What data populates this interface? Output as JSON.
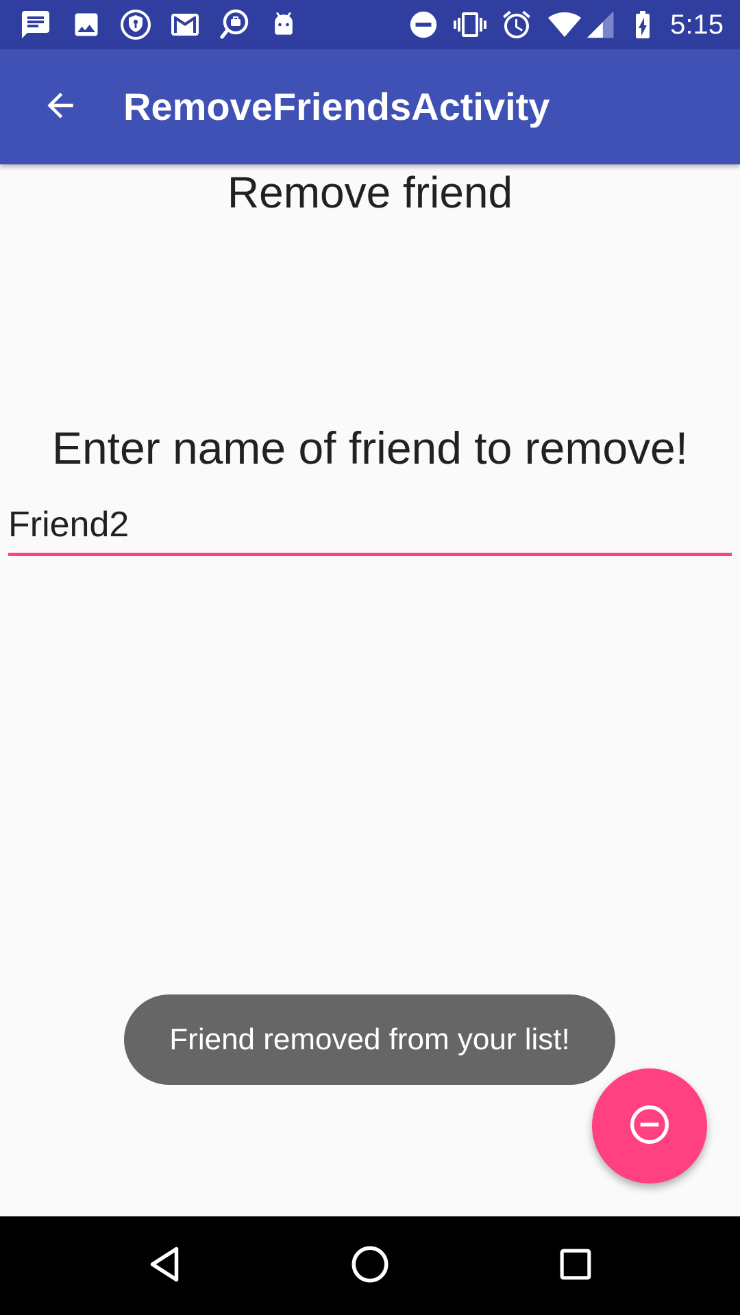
{
  "status_bar": {
    "time": "5:15",
    "left_icons": [
      "message-icon",
      "image-icon",
      "shield-key-icon",
      "gmail-icon",
      "chat-bubble-icon",
      "android-icon"
    ],
    "right_icons": [
      "do-not-disturb-icon",
      "vibrate-icon",
      "alarm-icon",
      "wifi-icon",
      "cell-signal-icon",
      "battery-charging-icon"
    ],
    "background": "#303f9f"
  },
  "app_bar": {
    "title": "RemoveFriendsActivity",
    "background": "#3f51b5"
  },
  "main": {
    "heading": "Remove friend",
    "prompt": "Enter name of friend to remove!",
    "name_input_value": "Friend2",
    "accent": "#ff4081"
  },
  "toast": {
    "message": "Friend removed from your list!"
  },
  "fab": {
    "icon": "remove-circle-icon",
    "color": "#ff4081"
  },
  "nav_bar": {
    "icons": [
      "back-triangle-icon",
      "home-circle-icon",
      "recents-square-icon"
    ]
  }
}
